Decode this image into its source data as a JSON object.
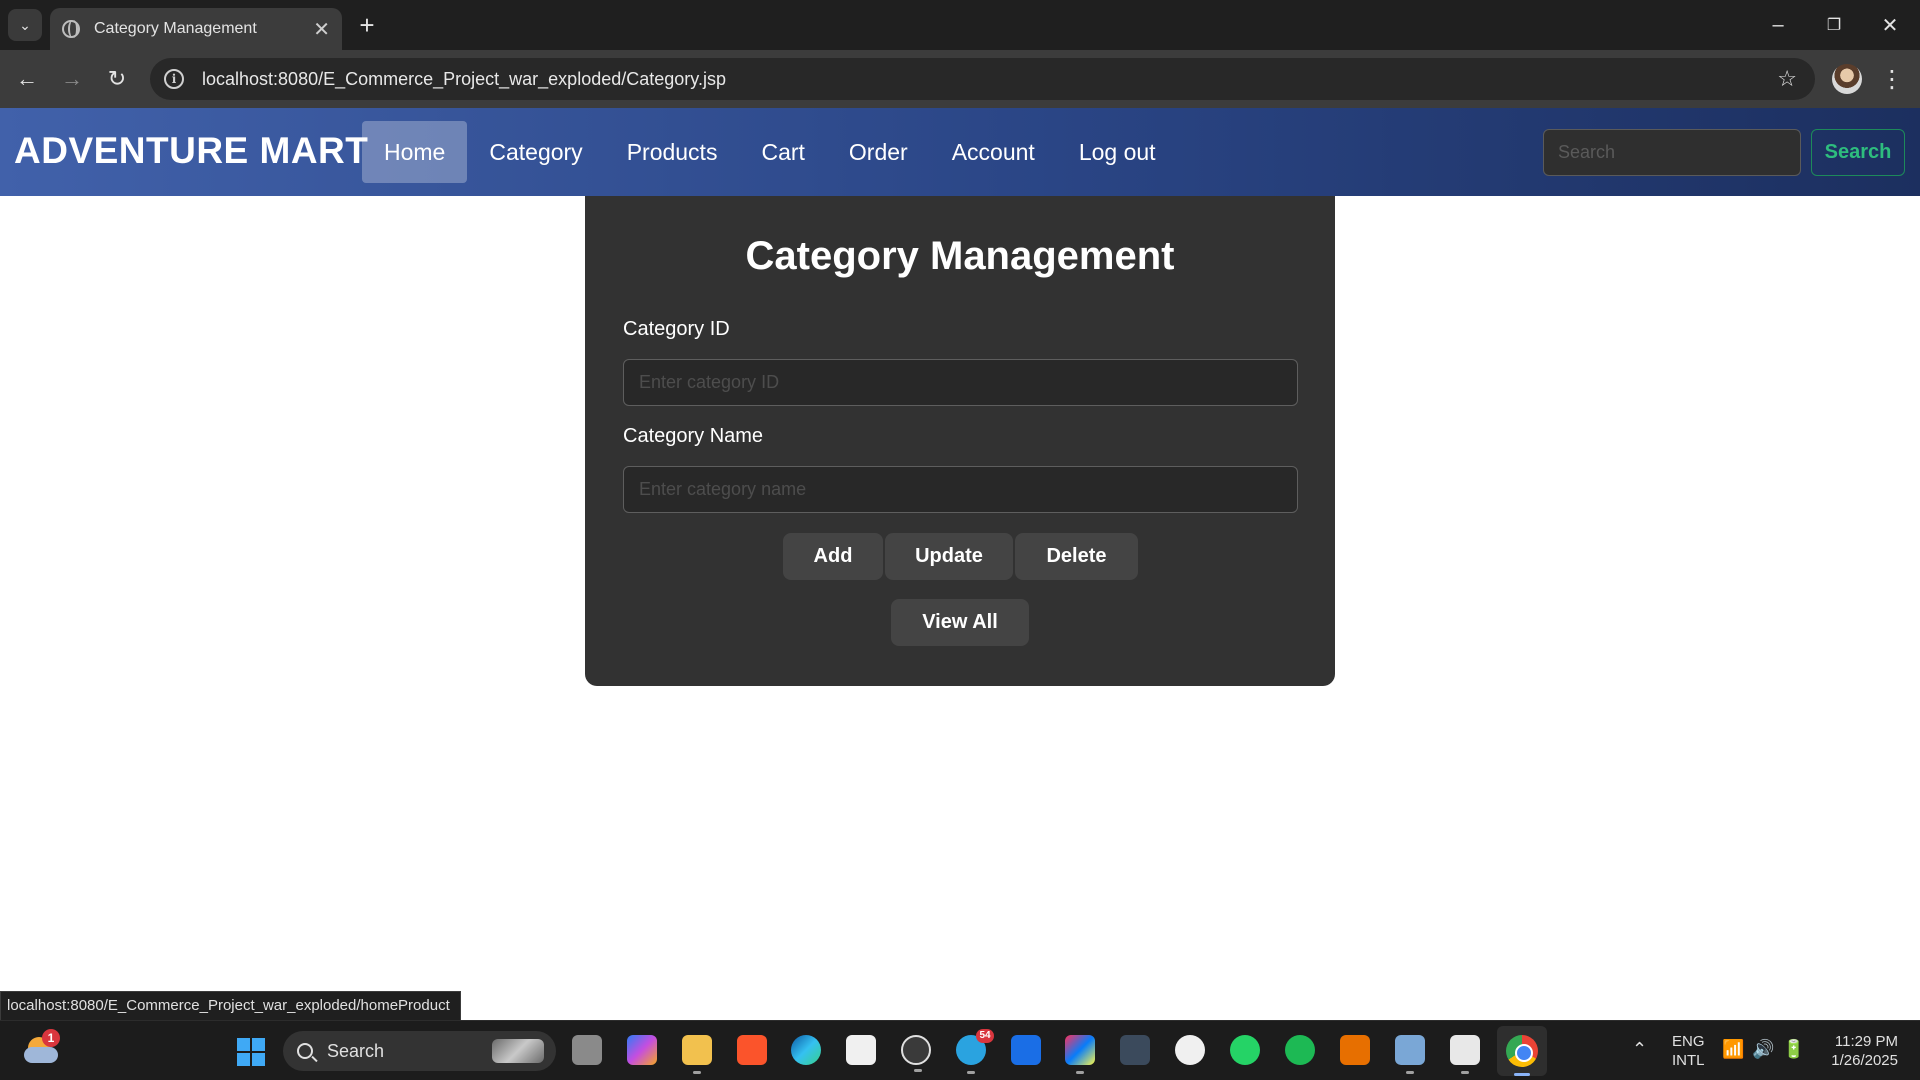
{
  "browser": {
    "tab_title": "Category Management",
    "url": "localhost:8080/E_Commerce_Project_war_exploded/Category.jsp",
    "status_url": "localhost:8080/E_Commerce_Project_war_exploded/homeProduct",
    "icons": {
      "tab_search": "chevron-down-icon",
      "tab_favicon": "globe-icon",
      "tab_close": "close-icon",
      "new_tab": "plus-icon",
      "back": "arrow-left-icon",
      "forward": "arrow-right-icon",
      "reload": "reload-icon",
      "site_info": "info-icon",
      "bookmark": "star-icon",
      "menu": "more-vert-icon"
    }
  },
  "site": {
    "brand": "ADVENTURE MART",
    "nav": [
      {
        "label": "Home",
        "active": true
      },
      {
        "label": "Category",
        "active": false
      },
      {
        "label": "Products",
        "active": false
      },
      {
        "label": "Cart",
        "active": false
      },
      {
        "label": "Order",
        "active": false
      },
      {
        "label": "Account",
        "active": false
      },
      {
        "label": "Log out",
        "active": false
      }
    ],
    "search_placeholder": "Search",
    "search_button": "Search",
    "colors": {
      "nav_gradient_start": "#4161aa",
      "nav_gradient_end": "#1c2f5f",
      "search_button_accent": "#2ebd7e",
      "card_background": "#323232"
    }
  },
  "form": {
    "title": "Category Management",
    "category_id_label": "Category ID",
    "category_id_placeholder": "Enter category ID",
    "category_id_value": "",
    "category_name_label": "Category Name",
    "category_name_placeholder": "Enter category name",
    "category_name_value": "",
    "add_button": "Add",
    "update_button": "Update",
    "delete_button": "Delete",
    "view_all_button": "View All"
  },
  "taskbar": {
    "search_label": "Search",
    "weather_badge": "1",
    "telegram_badge": "54",
    "lang_line1": "ENG",
    "lang_line2": "INTL",
    "time": "11:29 PM",
    "date": "1/26/2025",
    "apps": [
      "task-view",
      "copilot",
      "file-explorer",
      "brave",
      "edge",
      "microsoft-store",
      "media-player",
      "telegram",
      "vpn",
      "intellij-idea",
      "mysql-workbench",
      "github-desktop",
      "whatsapp",
      "spotify",
      "java",
      "resource-monitor",
      "snipping-tool",
      "chrome"
    ]
  }
}
